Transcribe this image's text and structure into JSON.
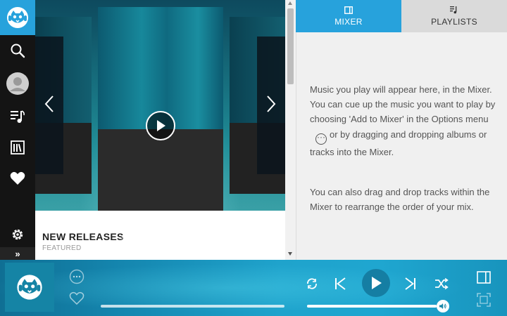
{
  "sidebar": {
    "logo_icon": "napster-cat-icon",
    "items": [
      {
        "name": "search",
        "icon": "search-icon"
      },
      {
        "name": "profile",
        "icon": "avatar"
      },
      {
        "name": "playlists",
        "icon": "music-list-icon"
      },
      {
        "name": "library",
        "icon": "library-icon"
      },
      {
        "name": "favorites",
        "icon": "heart-icon"
      },
      {
        "name": "settings",
        "icon": "gear-icon"
      }
    ],
    "expand_label": "»"
  },
  "main": {
    "section_title": "NEW RELEASES",
    "section_chevron": "›",
    "section_subtitle": "FEATURED"
  },
  "panel": {
    "tabs": [
      {
        "label": "MIXER",
        "active": true,
        "icon": "mixer-icon"
      },
      {
        "label": "PLAYLISTS",
        "active": false,
        "icon": "playlist-icon"
      }
    ],
    "para1_a": "Music you play will appear here, in the Mixer. You can cue up the music you want to play by choosing 'Add to Mixer' in the Options menu",
    "para1_b": "or by dragging and dropping albums or tracks into the Mixer.",
    "para2": "You can also drag and drop tracks within the Mixer to rearrange the order of your mix."
  },
  "player": {
    "progress_fraction": 1.0,
    "volume_fraction": 0.96,
    "colors": {
      "accent": "#27a2dc",
      "bar": "#1fa3cc"
    }
  }
}
